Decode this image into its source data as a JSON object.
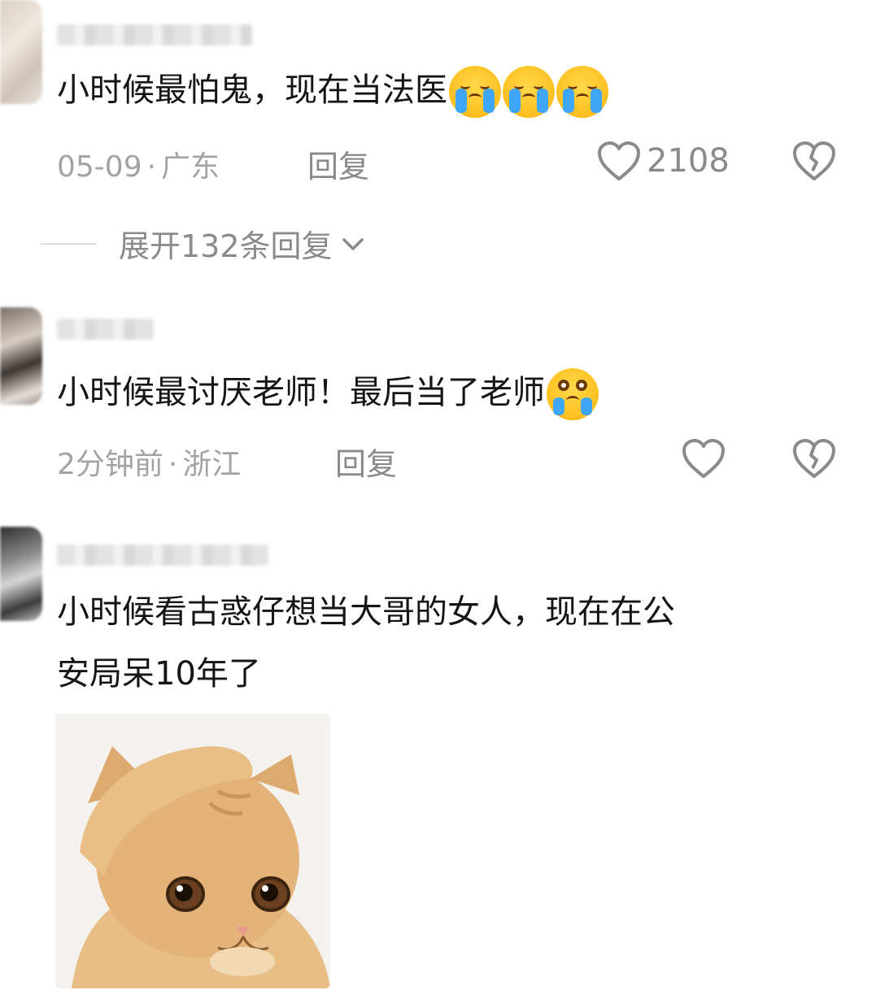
{
  "comments": [
    {
      "text": "小时候最怕鬼，现在当法医",
      "emojis": [
        "loudly-crying-face",
        "loudly-crying-face",
        "loudly-crying-face"
      ],
      "date": "05-09",
      "separator": "·",
      "location": "广东",
      "reply_label": "回复",
      "likes": "2108",
      "expand_label": "展开132条回复"
    },
    {
      "text": "小时候最讨厌老师！最后当了老师",
      "emojis": [
        "face-holding-back-tears"
      ],
      "date": "2分钟前",
      "separator": "·",
      "location": "浙江",
      "reply_label": "回复",
      "likes": ""
    },
    {
      "text_line1": "小时候看古惑仔想当大哥的女人，现在在公",
      "text_line2": "安局呆10年了",
      "image": "cat-meme-hand-on-head"
    }
  ],
  "colors": {
    "text": "#151515",
    "meta": "#a3a3a3",
    "icon": "#8a8a8a",
    "emoji_yellow": "#ffbf1f",
    "tear_blue": "#3ea6f5"
  }
}
